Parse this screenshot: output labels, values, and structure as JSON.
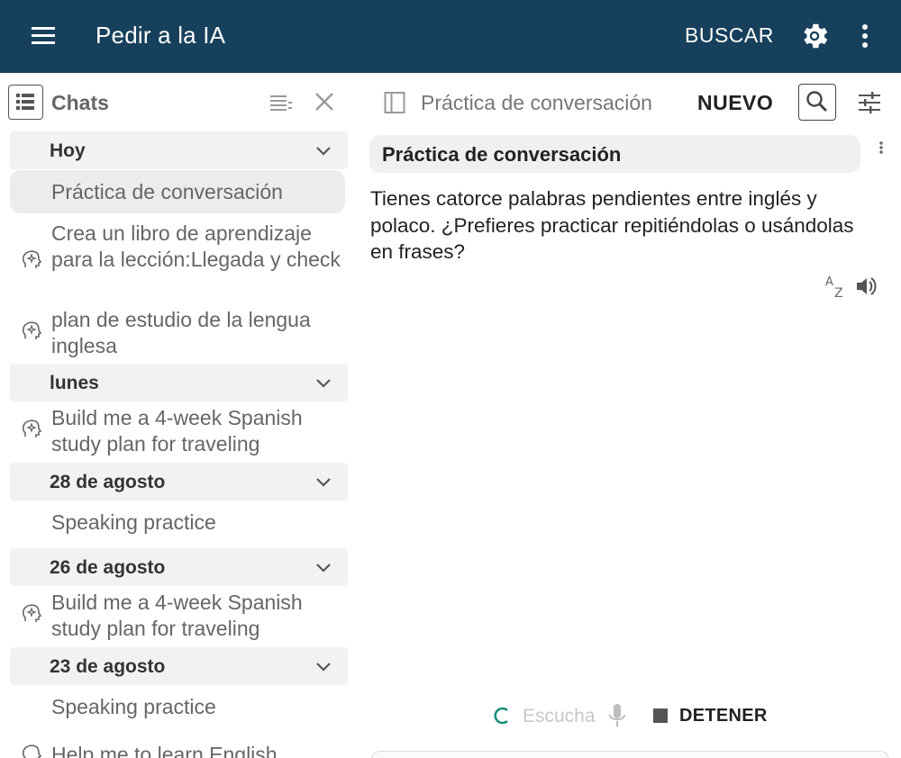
{
  "appbar": {
    "title": "Pedir a la IA",
    "search_label": "BUSCAR",
    "icons": {
      "menu": "menu-icon",
      "settings": "gear-icon",
      "more": "more-vert-icon"
    },
    "background": "#17405c"
  },
  "sidebar": {
    "title": "Chats",
    "groups": [
      {
        "label": "Hoy"
      },
      {
        "label": "lunes"
      },
      {
        "label": "28 de agosto"
      },
      {
        "label": "26 de agosto"
      },
      {
        "label": "23 de agosto"
      }
    ],
    "items": [
      {
        "label": "Práctica de conversación",
        "icon": "",
        "selected": true
      },
      {
        "label": "Crea un libro de aprendizaje para la lección:Llegada y check",
        "icon": "lightbulb-head-icon"
      },
      {
        "label": "plan de estudio de la lengua inglesa",
        "icon": "lightbulb-head-icon"
      },
      {
        "label": "Build me a 4-week Spanish study plan for traveling",
        "icon": "lightbulb-head-icon"
      },
      {
        "label": "Speaking practice",
        "icon": ""
      },
      {
        "label": "Build me a 4-week Spanish study plan for traveling",
        "icon": "lightbulb-head-icon"
      },
      {
        "label": "Speaking practice",
        "icon": ""
      },
      {
        "label": "Help me to learn English",
        "icon": "lightbulb-head-icon"
      }
    ]
  },
  "chat": {
    "title": "Práctica de conversación",
    "new_label": "NUEVO",
    "message_title": "Práctica de conversación",
    "message_body": "Tienes catorce palabras pendientes entre inglés y polaco. ¿Prefieres practicar repitiéndolas o usándolas en frases?",
    "listen_label": "Escucha",
    "stop_label": "DETENER",
    "accent": "#1a8f7a"
  }
}
